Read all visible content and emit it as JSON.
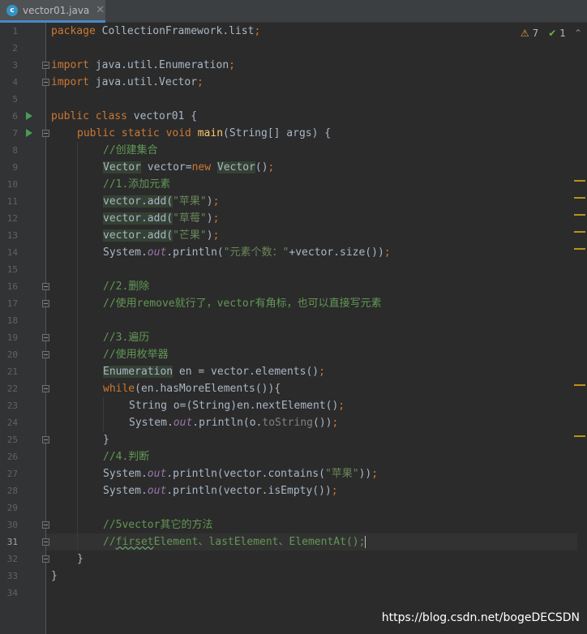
{
  "tab": {
    "icon": "java-class-icon",
    "icon_glyph": "c",
    "filename": "vector01.java",
    "close_glyph": "✕"
  },
  "inspection": {
    "warnings": "7",
    "weak_warnings": "1",
    "warning_glyph": "⚠",
    "weak_glyph": "✔"
  },
  "editor": {
    "current_line": 31,
    "line_numbers": [
      "1",
      "2",
      "3",
      "4",
      "5",
      "6",
      "7",
      "8",
      "9",
      "10",
      "11",
      "12",
      "13",
      "14",
      "15",
      "16",
      "17",
      "18",
      "19",
      "20",
      "21",
      "22",
      "23",
      "24",
      "25",
      "26",
      "27",
      "28",
      "29",
      "30",
      "31",
      "32",
      "33",
      "34"
    ],
    "code": {
      "l1_kw": "package",
      "l1_pkg": " CollectionFramework.list",
      "l1_semi": ";",
      "l3_kw": "import",
      "l3_pkg": " java.util.Enumeration",
      "l3_semi": ";",
      "l4_kw": "import",
      "l4_pkg": " java.util.Vector",
      "l4_semi": ";",
      "l6_kw": "public class",
      "l6_name": " vector01 {",
      "l7_kw": "public static void",
      "l7_fn": "main",
      "l7_rest": "(String[] args) {",
      "l8_cm": "//创建集合",
      "l9_t1": "Vector",
      "l9_mid": " vector=",
      "l9_new": "new",
      "l9_t2": "Vector",
      "l9_end": "()",
      "l9_semi": ";",
      "l10_cm": "//1.添加元素",
      "l11_call": "vector.add(",
      "l11_str": "\"苹果\"",
      "l11_end": ")",
      "l11_semi": ";",
      "l12_call": "vector.add(",
      "l12_str": "\"草莓\"",
      "l12_end": ")",
      "l12_semi": ";",
      "l13_call": "vector.add(",
      "l13_str": "\"芒果\"",
      "l13_end": ")",
      "l13_semi": ";",
      "l14_a": "System.",
      "l14_out": "out",
      "l14_b": ".println(",
      "l14_str": "\"元素个数：\"",
      "l14_c": "+vector.size())",
      "l14_semi": ";",
      "l16_cm": "//2.删除",
      "l17_cm": "//使用remove就行了，vector有角标，也可以直接写元素",
      "l19_cm": "//3.遍历",
      "l20_cm": "//使用枚举器",
      "l21_t": "Enumeration",
      "l21_rest": " en = vector.elements()",
      "l21_semi": ";",
      "l22_kw": "while",
      "l22_rest": "(en.hasMoreElements()){",
      "l23_a": "String o=(String)en.nextElement()",
      "l23_semi": ";",
      "l24_a": "System.",
      "l24_out": "out",
      "l24_b": ".println(o.",
      "l24_ts": "toString",
      "l24_c": "())",
      "l24_semi": ";",
      "l25": "}",
      "l26_cm": "//4.判断",
      "l27_a": "System.",
      "l27_out": "out",
      "l27_b": ".println(vector.contains(",
      "l27_str": "\"苹果\"",
      "l27_c": "))",
      "l27_semi": ";",
      "l28_a": "System.",
      "l28_out": "out",
      "l28_b": ".println(vector.isEmpty())",
      "l28_semi": ";",
      "l30_cm": "//5vector其它的方法",
      "l31_cm1": "//",
      "l31_typo": "firset",
      "l31_cm2": "Element、lastElement、ElementAt();",
      "l32": "}",
      "l33": "}"
    }
  },
  "watermark": "https://blog.csdn.net/bogeDECSDN",
  "colors": {
    "background": "#2b2b2b",
    "keyword": "#cc7832",
    "string": "#6a8759",
    "comment": "#629755",
    "method": "#ffc66d",
    "field": "#9876aa",
    "warning_marker": "#be9117"
  }
}
